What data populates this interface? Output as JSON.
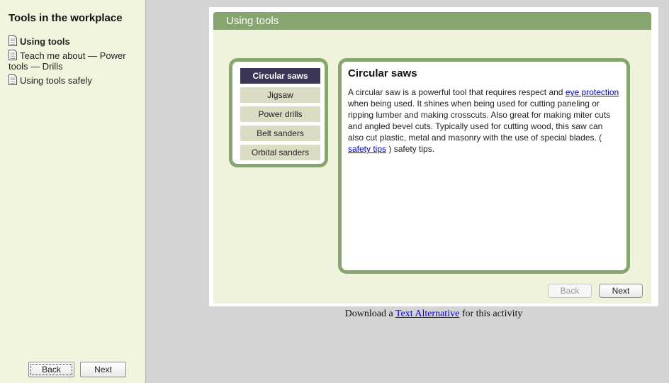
{
  "sidebar": {
    "title": "Tools in the workplace",
    "items": [
      {
        "label": "Using tools"
      },
      {
        "label": "Teach me about — Power tools — Drills"
      },
      {
        "label": "Using tools safely"
      }
    ],
    "back_label": "Back",
    "next_label": "Next"
  },
  "panel": {
    "header": "Using tools",
    "tabs": [
      "Circular saws",
      "Jigsaw",
      "Power drills",
      "Belt sanders",
      "Orbital sanders"
    ],
    "content": {
      "title": "Circular saws",
      "text_1": "A circular saw is a powerful tool that requires respect and ",
      "link_1": "eye protection",
      "text_2": " when being used. It shines when being used for cutting paneling or ripping lumber and making crosscuts. Also great for making miter cuts and angled bevel cuts. Typically used for cutting wood, this saw can also cut plastic, metal and masonry with the use of special blades. ( ",
      "link_2": "safety tips",
      "text_3": " ) safety tips."
    },
    "back_label": "Back",
    "next_label": "Next"
  },
  "download": {
    "prefix": "Download a ",
    "link": "Text Alternative",
    "suffix": " for this activity"
  }
}
